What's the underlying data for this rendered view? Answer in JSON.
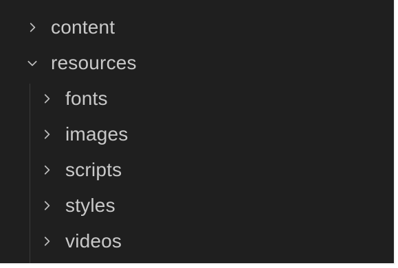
{
  "explorer": {
    "items": [
      {
        "label": "content",
        "expanded": false,
        "level": 0,
        "icon": "chevron-right-icon"
      },
      {
        "label": "resources",
        "expanded": true,
        "level": 0,
        "icon": "chevron-down-icon"
      },
      {
        "label": "fonts",
        "expanded": false,
        "level": 1,
        "icon": "chevron-right-icon"
      },
      {
        "label": "images",
        "expanded": false,
        "level": 1,
        "icon": "chevron-right-icon"
      },
      {
        "label": "scripts",
        "expanded": false,
        "level": 1,
        "icon": "chevron-right-icon"
      },
      {
        "label": "styles",
        "expanded": false,
        "level": 1,
        "icon": "chevron-right-icon"
      },
      {
        "label": "videos",
        "expanded": false,
        "level": 1,
        "icon": "chevron-right-icon"
      }
    ]
  },
  "colors": {
    "background": "#1f1f1f",
    "text": "#c9c9c9",
    "chevron": "#bdbdbd",
    "indent_guide": "#3b3b3b"
  }
}
